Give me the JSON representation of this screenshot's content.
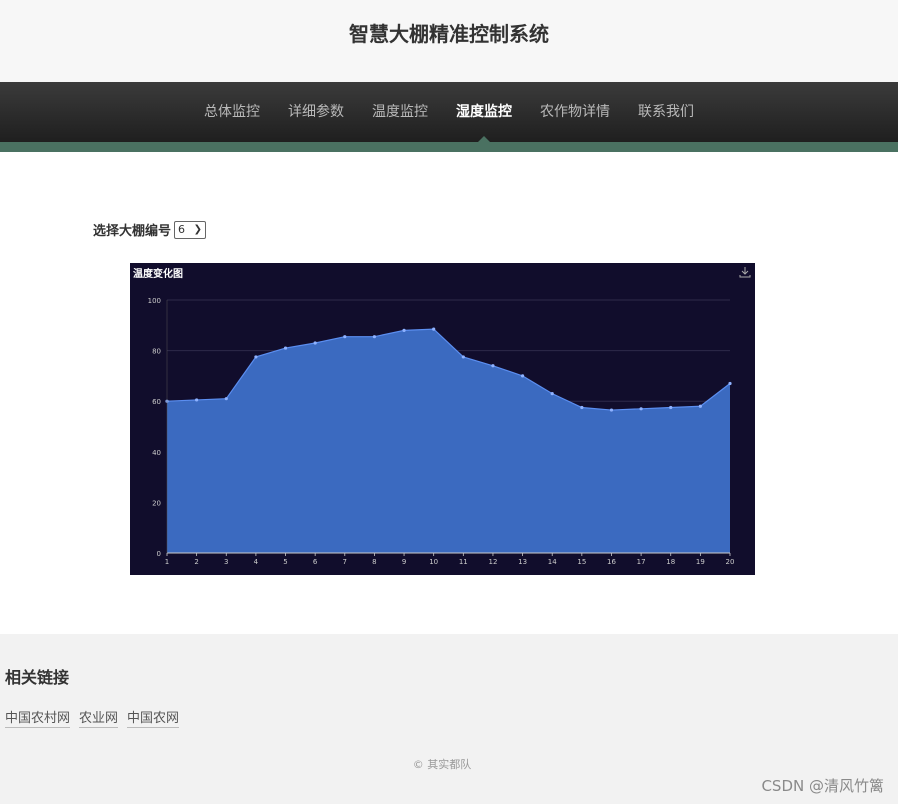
{
  "header": {
    "title": "智慧大棚精准控制系统"
  },
  "nav": {
    "items": [
      {
        "label": "总体监控",
        "active": false
      },
      {
        "label": "详细参数",
        "active": false
      },
      {
        "label": "温度监控",
        "active": false
      },
      {
        "label": "湿度监控",
        "active": true
      },
      {
        "label": "农作物详情",
        "active": false
      },
      {
        "label": "联系我们",
        "active": false
      }
    ]
  },
  "selector": {
    "label": "选择大棚编号",
    "value": "6"
  },
  "chart_data": {
    "type": "area",
    "title": "温度变化图",
    "x": [
      1,
      2,
      3,
      4,
      5,
      6,
      7,
      8,
      9,
      10,
      11,
      12,
      13,
      14,
      15,
      16,
      17,
      18,
      19,
      20
    ],
    "series": [
      {
        "values": [
          60,
          60.5,
          61,
          77.5,
          81,
          83,
          85.5,
          85.5,
          88,
          88.5,
          77.5,
          74,
          70,
          63,
          57.5,
          56.5,
          57,
          57.5,
          58,
          67
        ]
      }
    ],
    "ylim": [
      0,
      100
    ],
    "yticks": [
      0,
      20,
      40,
      60,
      80,
      100
    ],
    "grid": true,
    "colors": {
      "fill": "#3b6ac0",
      "line": "#5b8ef0",
      "background": "#110d2c",
      "axis": "#cccccc"
    }
  },
  "footer": {
    "heading": "相关链接",
    "links": [
      "中国农村网",
      "农业网",
      "中国农网"
    ],
    "copyright": "© 其实都队"
  },
  "watermark": "CSDN @清风竹篱",
  "icons": {
    "download": "download-icon",
    "select_arrow": "chevron-down-icon"
  }
}
